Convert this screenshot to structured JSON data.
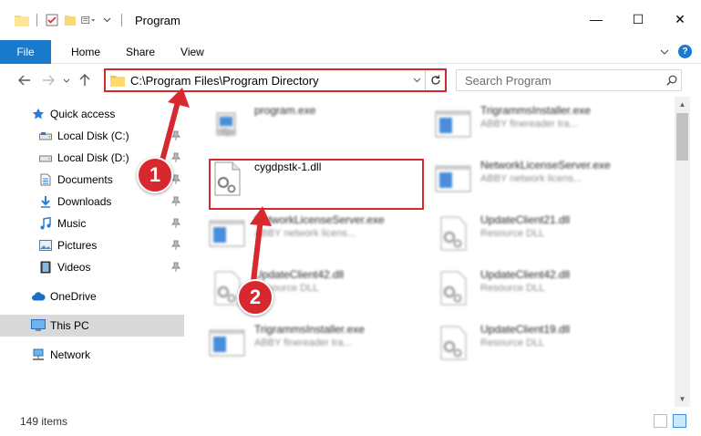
{
  "window": {
    "title": "Program",
    "minimize": "—",
    "maximize": "☐",
    "close": "✕"
  },
  "ribbon": {
    "file": "File",
    "tabs": [
      "Home",
      "Share",
      "View"
    ],
    "help": "?"
  },
  "address": {
    "path": "C:\\Program Files\\Program Directory"
  },
  "search": {
    "placeholder": "Search Program"
  },
  "sidebar": {
    "items": [
      {
        "label": "Quick access",
        "icon": "star-icon"
      },
      {
        "label": "Local Disk (C:)",
        "icon": "drive-icon"
      },
      {
        "label": "Local Disk (D:)",
        "icon": "drive-icon"
      },
      {
        "label": "Documents",
        "icon": "documents-icon"
      },
      {
        "label": "Downloads",
        "icon": "downloads-icon"
      },
      {
        "label": "Music",
        "icon": "music-icon"
      },
      {
        "label": "Pictures",
        "icon": "pictures-icon"
      },
      {
        "label": "Videos",
        "icon": "videos-icon"
      },
      {
        "label": "OneDrive",
        "icon": "cloud-icon"
      },
      {
        "label": "This PC",
        "icon": "computer-icon"
      },
      {
        "label": "Network",
        "icon": "network-icon"
      }
    ]
  },
  "files": [
    {
      "name": "program.exe",
      "desc": "",
      "icon": "installer-icon"
    },
    {
      "name": "TrigrammsInstaller.exe",
      "desc": "ABBY finereader tra...",
      "icon": "app-window-icon"
    },
    {
      "name": "cygdpstk-1.dll",
      "desc": "",
      "icon": "dll-gear-icon"
    },
    {
      "name": "NetworkLicenseServer.exe",
      "desc": "ABBY network licens...",
      "icon": "app-window-icon"
    },
    {
      "name": "NetworkLicenseServer.exe",
      "desc": "ABBY network licens...",
      "icon": "app-window-icon"
    },
    {
      "name": "UpdateClient21.dll",
      "desc": "Resource DLL",
      "icon": "dll-gear-icon"
    },
    {
      "name": "UpdateClient42.dll",
      "desc": "Resource DLL",
      "icon": "dll-gear-icon"
    },
    {
      "name": "UpdateClient42.dll",
      "desc": "Resource DLL",
      "icon": "dll-gear-icon"
    },
    {
      "name": "TrigrammsInstaller.exe",
      "desc": "ABBY finereader tra...",
      "icon": "app-window-icon"
    },
    {
      "name": "UpdateClient19.dll",
      "desc": "Resource DLL",
      "icon": "dll-gear-icon"
    }
  ],
  "status": {
    "count": "149 items"
  },
  "annotations": {
    "step1": "1",
    "step2": "2"
  },
  "colors": {
    "accent": "#1979ca",
    "highlight": "#d7282f",
    "selection": "#cce8ff"
  }
}
